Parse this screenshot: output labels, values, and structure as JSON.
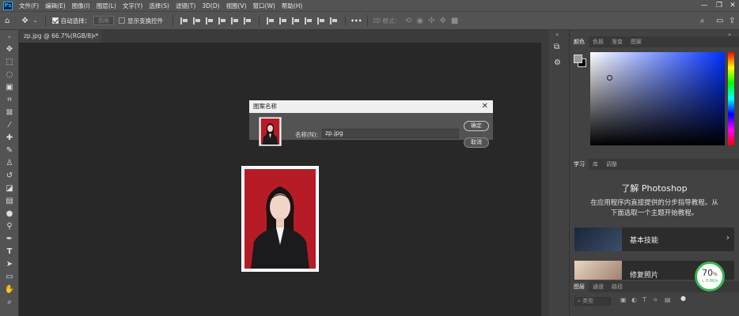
{
  "menubar": {
    "logo": "Ps",
    "items": [
      "文件(F)",
      "编辑(E)",
      "图像(I)",
      "图层(L)",
      "文字(Y)",
      "选择(S)",
      "滤镜(T)",
      "3D(D)",
      "视图(V)",
      "窗口(W)",
      "帮助(H)"
    ],
    "window_controls": [
      "—",
      "❐",
      "✕"
    ]
  },
  "options": {
    "auto_select_label": "自动选择：",
    "auto_select_value": "图层",
    "show_transform_label": "显示变换控件",
    "more": "•••",
    "mode_3d_label": "3D 模式："
  },
  "document": {
    "tab_label": "zp.jpg @ 66.7%(RGB/8) *",
    "tab_close": "×"
  },
  "dialog": {
    "title": "图案名称",
    "name_label": "名称(N):",
    "name_value": "zp.jpg",
    "ok_label": "确定",
    "cancel_label": "取消"
  },
  "panels": {
    "color_tabs": [
      "颜色",
      "色板",
      "渐变",
      "图案"
    ],
    "learn_tabs": [
      "学习",
      "库",
      "调整"
    ],
    "learn_title": "了解 Photoshop",
    "learn_desc_line1": "在应用程序内直接提供的分步指导教程。从",
    "learn_desc_line2": "下面选取一个主题开始教程。",
    "cards": [
      {
        "label": "基本技能"
      },
      {
        "label": "修复照片"
      }
    ],
    "layers_tabs": [
      "图层",
      "通道",
      "路径"
    ],
    "layers_filter_placeholder": "类型"
  },
  "overlay": {
    "percent": "70",
    "percent_unit": "%",
    "speed": "↓ 0.6K/s"
  }
}
